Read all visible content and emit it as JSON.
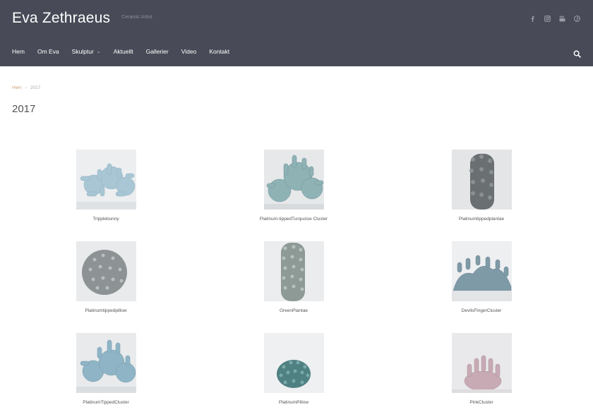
{
  "header": {
    "title": "Eva Zethraeus",
    "tagline": "Ceramic Artist",
    "social_icons": [
      "facebook-icon",
      "instagram-icon",
      "youtube-icon",
      "pinterest-icon"
    ]
  },
  "nav": {
    "items": [
      {
        "label": "Hem"
      },
      {
        "label": "Om Eva"
      },
      {
        "label": "Skulptur",
        "has_dropdown": true
      },
      {
        "label": "Aktuellt"
      },
      {
        "label": "Gallerier"
      },
      {
        "label": "Video"
      },
      {
        "label": "Kontakt"
      }
    ],
    "search_icon": "search-icon"
  },
  "breadcrumb": {
    "home": "Hem",
    "separator": "›",
    "current": "2017"
  },
  "page": {
    "title": "2017"
  },
  "gallery": {
    "items": [
      {
        "caption": "Tripplebunny"
      },
      {
        "caption": "Platinum-tippedTurquoise Cluster"
      },
      {
        "caption": "Platinumtippedplantae"
      },
      {
        "caption": "Platinumtippedpillow"
      },
      {
        "caption": "GreenPlantae"
      },
      {
        "caption": "DevilsFingerCluster"
      },
      {
        "caption": "PlatinumTippedCluster"
      },
      {
        "caption": "PlatinumPillow"
      },
      {
        "caption": "PinkCluster"
      }
    ]
  },
  "colors": {
    "header_bg": "#484b57",
    "accent": "#c8a070"
  }
}
